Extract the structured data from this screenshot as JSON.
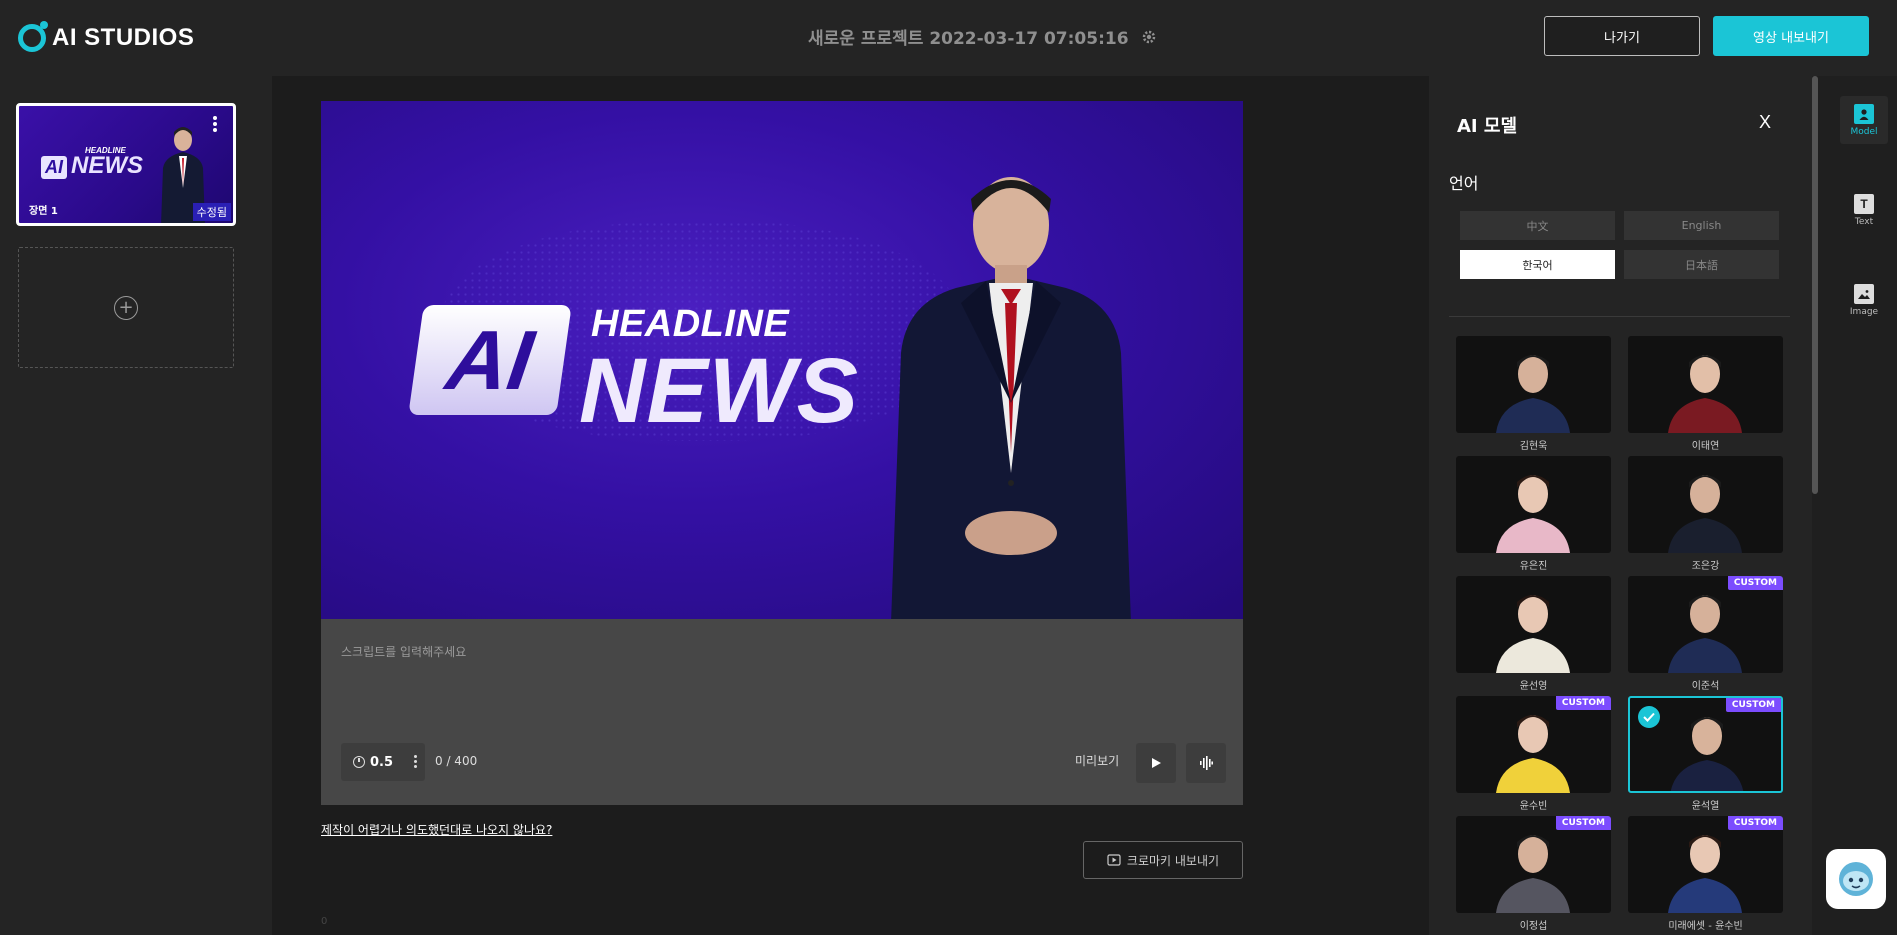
{
  "app": {
    "logo_text": "AI STUDIOS"
  },
  "header": {
    "project_title": "새로운 프로젝트 2022-03-17 07:05:16",
    "exit_label": "나가기",
    "export_label": "영상 내보내기"
  },
  "scenes": {
    "items": [
      {
        "label": "장면 1",
        "badge": "수정됨",
        "thumb_ai": "AI",
        "thumb_news": "NEWS",
        "thumb_headline": "HEADLINE"
      }
    ]
  },
  "stage": {
    "logo_ai": "AI",
    "headline": "HEADLINE",
    "news": "NEWS"
  },
  "script": {
    "placeholder": "스크립트를 입력해주세요",
    "speed": "0.5",
    "char_count": "0 / 400",
    "preview_label": "미리보기"
  },
  "footer": {
    "help_link": "제작이 어렵거나 의도했던대로 나오지 않나요?",
    "chroma_label": "크로마키 내보내기",
    "stray_text": "0"
  },
  "panel": {
    "title": "AI 모델",
    "close_label": "X",
    "language_title": "언어",
    "languages": [
      {
        "label": "中文",
        "active": false
      },
      {
        "label": "English",
        "active": false
      },
      {
        "label": "한국어",
        "active": true
      },
      {
        "label": "日本語",
        "active": false
      }
    ],
    "models": [
      {
        "name": "김현욱",
        "custom": false,
        "selected": false
      },
      {
        "name": "이태연",
        "custom": false,
        "selected": false
      },
      {
        "name": "유은진",
        "custom": false,
        "selected": false
      },
      {
        "name": "조은강",
        "custom": false,
        "selected": false
      },
      {
        "name": "윤선영",
        "custom": false,
        "selected": false
      },
      {
        "name": "이준석",
        "custom": true,
        "selected": false
      },
      {
        "name": "윤수빈",
        "custom": true,
        "selected": false
      },
      {
        "name": "윤석열",
        "custom": true,
        "selected": true
      },
      {
        "name": "이정섭",
        "custom": true,
        "selected": false
      },
      {
        "name": "미래에셋 - 윤수빈",
        "custom": true,
        "selected": false
      }
    ],
    "custom_badge": "CUSTOM"
  },
  "side_tabs": [
    {
      "label": "Model",
      "icon": "person-icon",
      "active": true
    },
    {
      "label": "Text",
      "icon": "text-icon",
      "active": false
    },
    {
      "label": "Image",
      "icon": "image-icon",
      "active": false
    }
  ],
  "colors": {
    "accent": "#1bc5d6",
    "custom_badge": "#7c4dff",
    "stage_bg": "#3410a4"
  }
}
